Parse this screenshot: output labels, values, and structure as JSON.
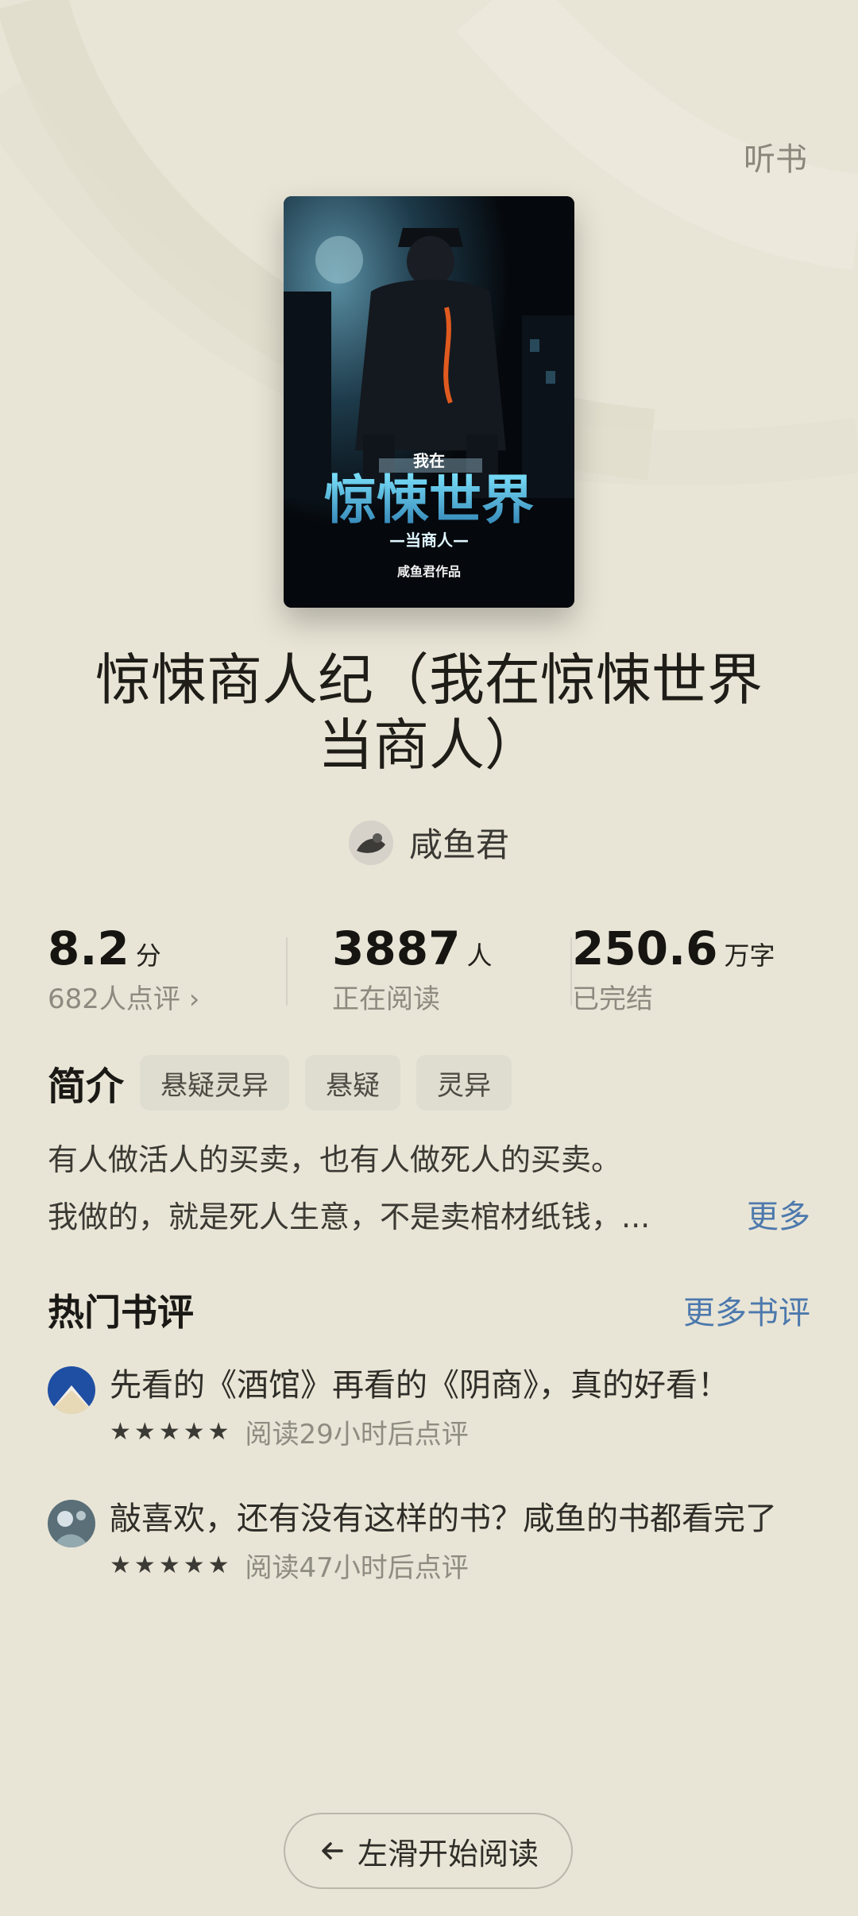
{
  "header": {
    "listen_label": "听书"
  },
  "book": {
    "title": "惊悚商人纪（我在惊悚世界当商人）",
    "author": "咸鱼君",
    "cover_texts": {
      "small": "我在",
      "big": "惊悚世界",
      "sub": "—当商人—",
      "credit": "咸鱼君作品"
    }
  },
  "stats": {
    "score": {
      "value": "8.2",
      "unit": "分",
      "sub": "682人点评 ›"
    },
    "readers": {
      "value": "3887",
      "unit": "人",
      "sub": "正在阅读"
    },
    "words": {
      "value": "250.6",
      "unit": "万字",
      "sub": "已完结"
    }
  },
  "intro": {
    "label": "简介",
    "tags": [
      "悬疑灵异",
      "悬疑",
      "灵异"
    ],
    "line1": "有人做活人的买卖，也有人做死人的买卖。",
    "line2": "我做的，就是死人生意，不是卖棺材纸钱，...",
    "more": "更多"
  },
  "reviews": {
    "title": "热门书评",
    "more": "更多书评",
    "items": [
      {
        "text": "先看的《酒馆》再看的《阴商》，真的好看！",
        "stars": 5,
        "meta": "阅读29小时后点评"
      },
      {
        "text": "敲喜欢，还有没有这样的书？咸鱼的书都看完了",
        "stars": 5,
        "meta": "阅读47小时后点评"
      }
    ]
  },
  "footer": {
    "start_label": "左滑开始阅读"
  },
  "colors": {
    "background": "#e9e5d6",
    "link": "#4d79ad",
    "tag_bg": "#deddcf"
  }
}
